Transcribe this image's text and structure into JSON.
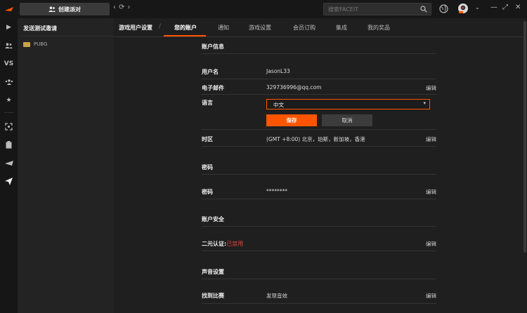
{
  "topbar": {
    "create_party_label": "创建派对",
    "search_placeholder": "搜索FACEIT"
  },
  "sidebar2": {
    "header": "发送测试邀请",
    "game": "PUBG"
  },
  "rail": {
    "vs_label": "VS"
  },
  "tabs": [
    {
      "label": "游戏用户设置"
    },
    {
      "label": "您的账户"
    },
    {
      "label": "通知"
    },
    {
      "label": "游戏设置"
    },
    {
      "label": "会员订购"
    },
    {
      "label": "集成"
    },
    {
      "label": "我的奖品"
    }
  ],
  "account": {
    "section_title": "账户信息",
    "username_label": "用户名",
    "username_value": "JasonL33",
    "email_label": "电子邮件",
    "email_value": "329736996@qq.com",
    "language_label": "语言",
    "language_value": "中文",
    "save_label": "保存",
    "cancel_label": "取消",
    "timezone_label": "时区",
    "timezone_value": "(GMT +8:00) 北京，珀斯，新加坡，香港",
    "edit_label": "编辑"
  },
  "password": {
    "section_title": "密码",
    "label": "密码",
    "value": "********"
  },
  "security": {
    "section_title": "账户安全",
    "twofa_label": "二元认证:",
    "twofa_status": "已禁用"
  },
  "sound": {
    "section_title": "声音设置",
    "match_found_label": "找到比赛",
    "match_found_value": "发现音效"
  },
  "colors": {
    "accent": "#ff5500",
    "disabled_red": "#e0413b"
  }
}
